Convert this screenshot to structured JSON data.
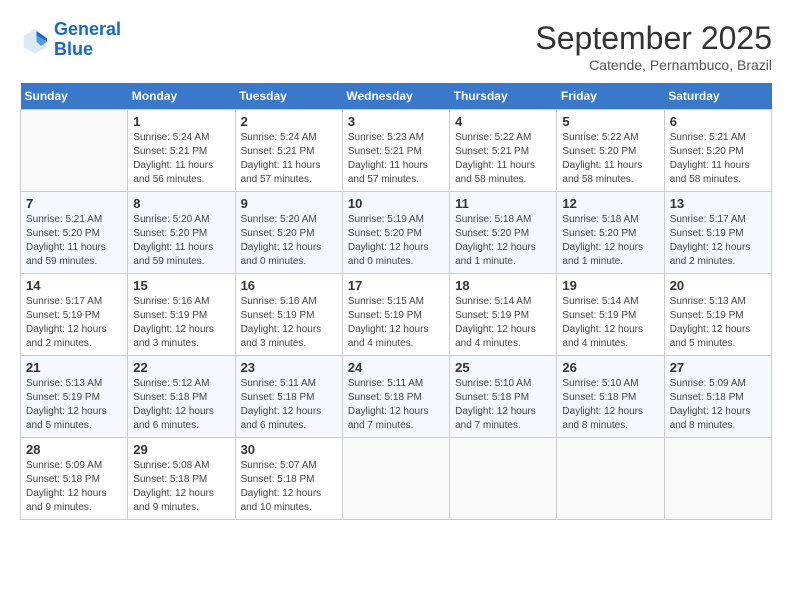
{
  "logo": {
    "line1": "General",
    "line2": "Blue"
  },
  "title": "September 2025",
  "subtitle": "Catende, Pernambuco, Brazil",
  "days_of_week": [
    "Sunday",
    "Monday",
    "Tuesday",
    "Wednesday",
    "Thursday",
    "Friday",
    "Saturday"
  ],
  "weeks": [
    [
      {
        "day": "",
        "info": ""
      },
      {
        "day": "1",
        "info": "Sunrise: 5:24 AM\nSunset: 5:21 PM\nDaylight: 11 hours\nand 56 minutes."
      },
      {
        "day": "2",
        "info": "Sunrise: 5:24 AM\nSunset: 5:21 PM\nDaylight: 11 hours\nand 57 minutes."
      },
      {
        "day": "3",
        "info": "Sunrise: 5:23 AM\nSunset: 5:21 PM\nDaylight: 11 hours\nand 57 minutes."
      },
      {
        "day": "4",
        "info": "Sunrise: 5:22 AM\nSunset: 5:21 PM\nDaylight: 11 hours\nand 58 minutes."
      },
      {
        "day": "5",
        "info": "Sunrise: 5:22 AM\nSunset: 5:20 PM\nDaylight: 11 hours\nand 58 minutes."
      },
      {
        "day": "6",
        "info": "Sunrise: 5:21 AM\nSunset: 5:20 PM\nDaylight: 11 hours\nand 58 minutes."
      }
    ],
    [
      {
        "day": "7",
        "info": "Sunrise: 5:21 AM\nSunset: 5:20 PM\nDaylight: 11 hours\nand 59 minutes."
      },
      {
        "day": "8",
        "info": "Sunrise: 5:20 AM\nSunset: 5:20 PM\nDaylight: 11 hours\nand 59 minutes."
      },
      {
        "day": "9",
        "info": "Sunrise: 5:20 AM\nSunset: 5:20 PM\nDaylight: 12 hours\nand 0 minutes."
      },
      {
        "day": "10",
        "info": "Sunrise: 5:19 AM\nSunset: 5:20 PM\nDaylight: 12 hours\nand 0 minutes."
      },
      {
        "day": "11",
        "info": "Sunrise: 5:18 AM\nSunset: 5:20 PM\nDaylight: 12 hours\nand 1 minute."
      },
      {
        "day": "12",
        "info": "Sunrise: 5:18 AM\nSunset: 5:20 PM\nDaylight: 12 hours\nand 1 minute."
      },
      {
        "day": "13",
        "info": "Sunrise: 5:17 AM\nSunset: 5:19 PM\nDaylight: 12 hours\nand 2 minutes."
      }
    ],
    [
      {
        "day": "14",
        "info": "Sunrise: 5:17 AM\nSunset: 5:19 PM\nDaylight: 12 hours\nand 2 minutes."
      },
      {
        "day": "15",
        "info": "Sunrise: 5:16 AM\nSunset: 5:19 PM\nDaylight: 12 hours\nand 3 minutes."
      },
      {
        "day": "16",
        "info": "Sunrise: 5:16 AM\nSunset: 5:19 PM\nDaylight: 12 hours\nand 3 minutes."
      },
      {
        "day": "17",
        "info": "Sunrise: 5:15 AM\nSunset: 5:19 PM\nDaylight: 12 hours\nand 4 minutes."
      },
      {
        "day": "18",
        "info": "Sunrise: 5:14 AM\nSunset: 5:19 PM\nDaylight: 12 hours\nand 4 minutes."
      },
      {
        "day": "19",
        "info": "Sunrise: 5:14 AM\nSunset: 5:19 PM\nDaylight: 12 hours\nand 4 minutes."
      },
      {
        "day": "20",
        "info": "Sunrise: 5:13 AM\nSunset: 5:19 PM\nDaylight: 12 hours\nand 5 minutes."
      }
    ],
    [
      {
        "day": "21",
        "info": "Sunrise: 5:13 AM\nSunset: 5:19 PM\nDaylight: 12 hours\nand 5 minutes."
      },
      {
        "day": "22",
        "info": "Sunrise: 5:12 AM\nSunset: 5:18 PM\nDaylight: 12 hours\nand 6 minutes."
      },
      {
        "day": "23",
        "info": "Sunrise: 5:11 AM\nSunset: 5:18 PM\nDaylight: 12 hours\nand 6 minutes."
      },
      {
        "day": "24",
        "info": "Sunrise: 5:11 AM\nSunset: 5:18 PM\nDaylight: 12 hours\nand 7 minutes."
      },
      {
        "day": "25",
        "info": "Sunrise: 5:10 AM\nSunset: 5:18 PM\nDaylight: 12 hours\nand 7 minutes."
      },
      {
        "day": "26",
        "info": "Sunrise: 5:10 AM\nSunset: 5:18 PM\nDaylight: 12 hours\nand 8 minutes."
      },
      {
        "day": "27",
        "info": "Sunrise: 5:09 AM\nSunset: 5:18 PM\nDaylight: 12 hours\nand 8 minutes."
      }
    ],
    [
      {
        "day": "28",
        "info": "Sunrise: 5:09 AM\nSunset: 5:18 PM\nDaylight: 12 hours\nand 9 minutes."
      },
      {
        "day": "29",
        "info": "Sunrise: 5:08 AM\nSunset: 5:18 PM\nDaylight: 12 hours\nand 9 minutes."
      },
      {
        "day": "30",
        "info": "Sunrise: 5:07 AM\nSunset: 5:18 PM\nDaylight: 12 hours\nand 10 minutes."
      },
      {
        "day": "",
        "info": ""
      },
      {
        "day": "",
        "info": ""
      },
      {
        "day": "",
        "info": ""
      },
      {
        "day": "",
        "info": ""
      }
    ]
  ]
}
